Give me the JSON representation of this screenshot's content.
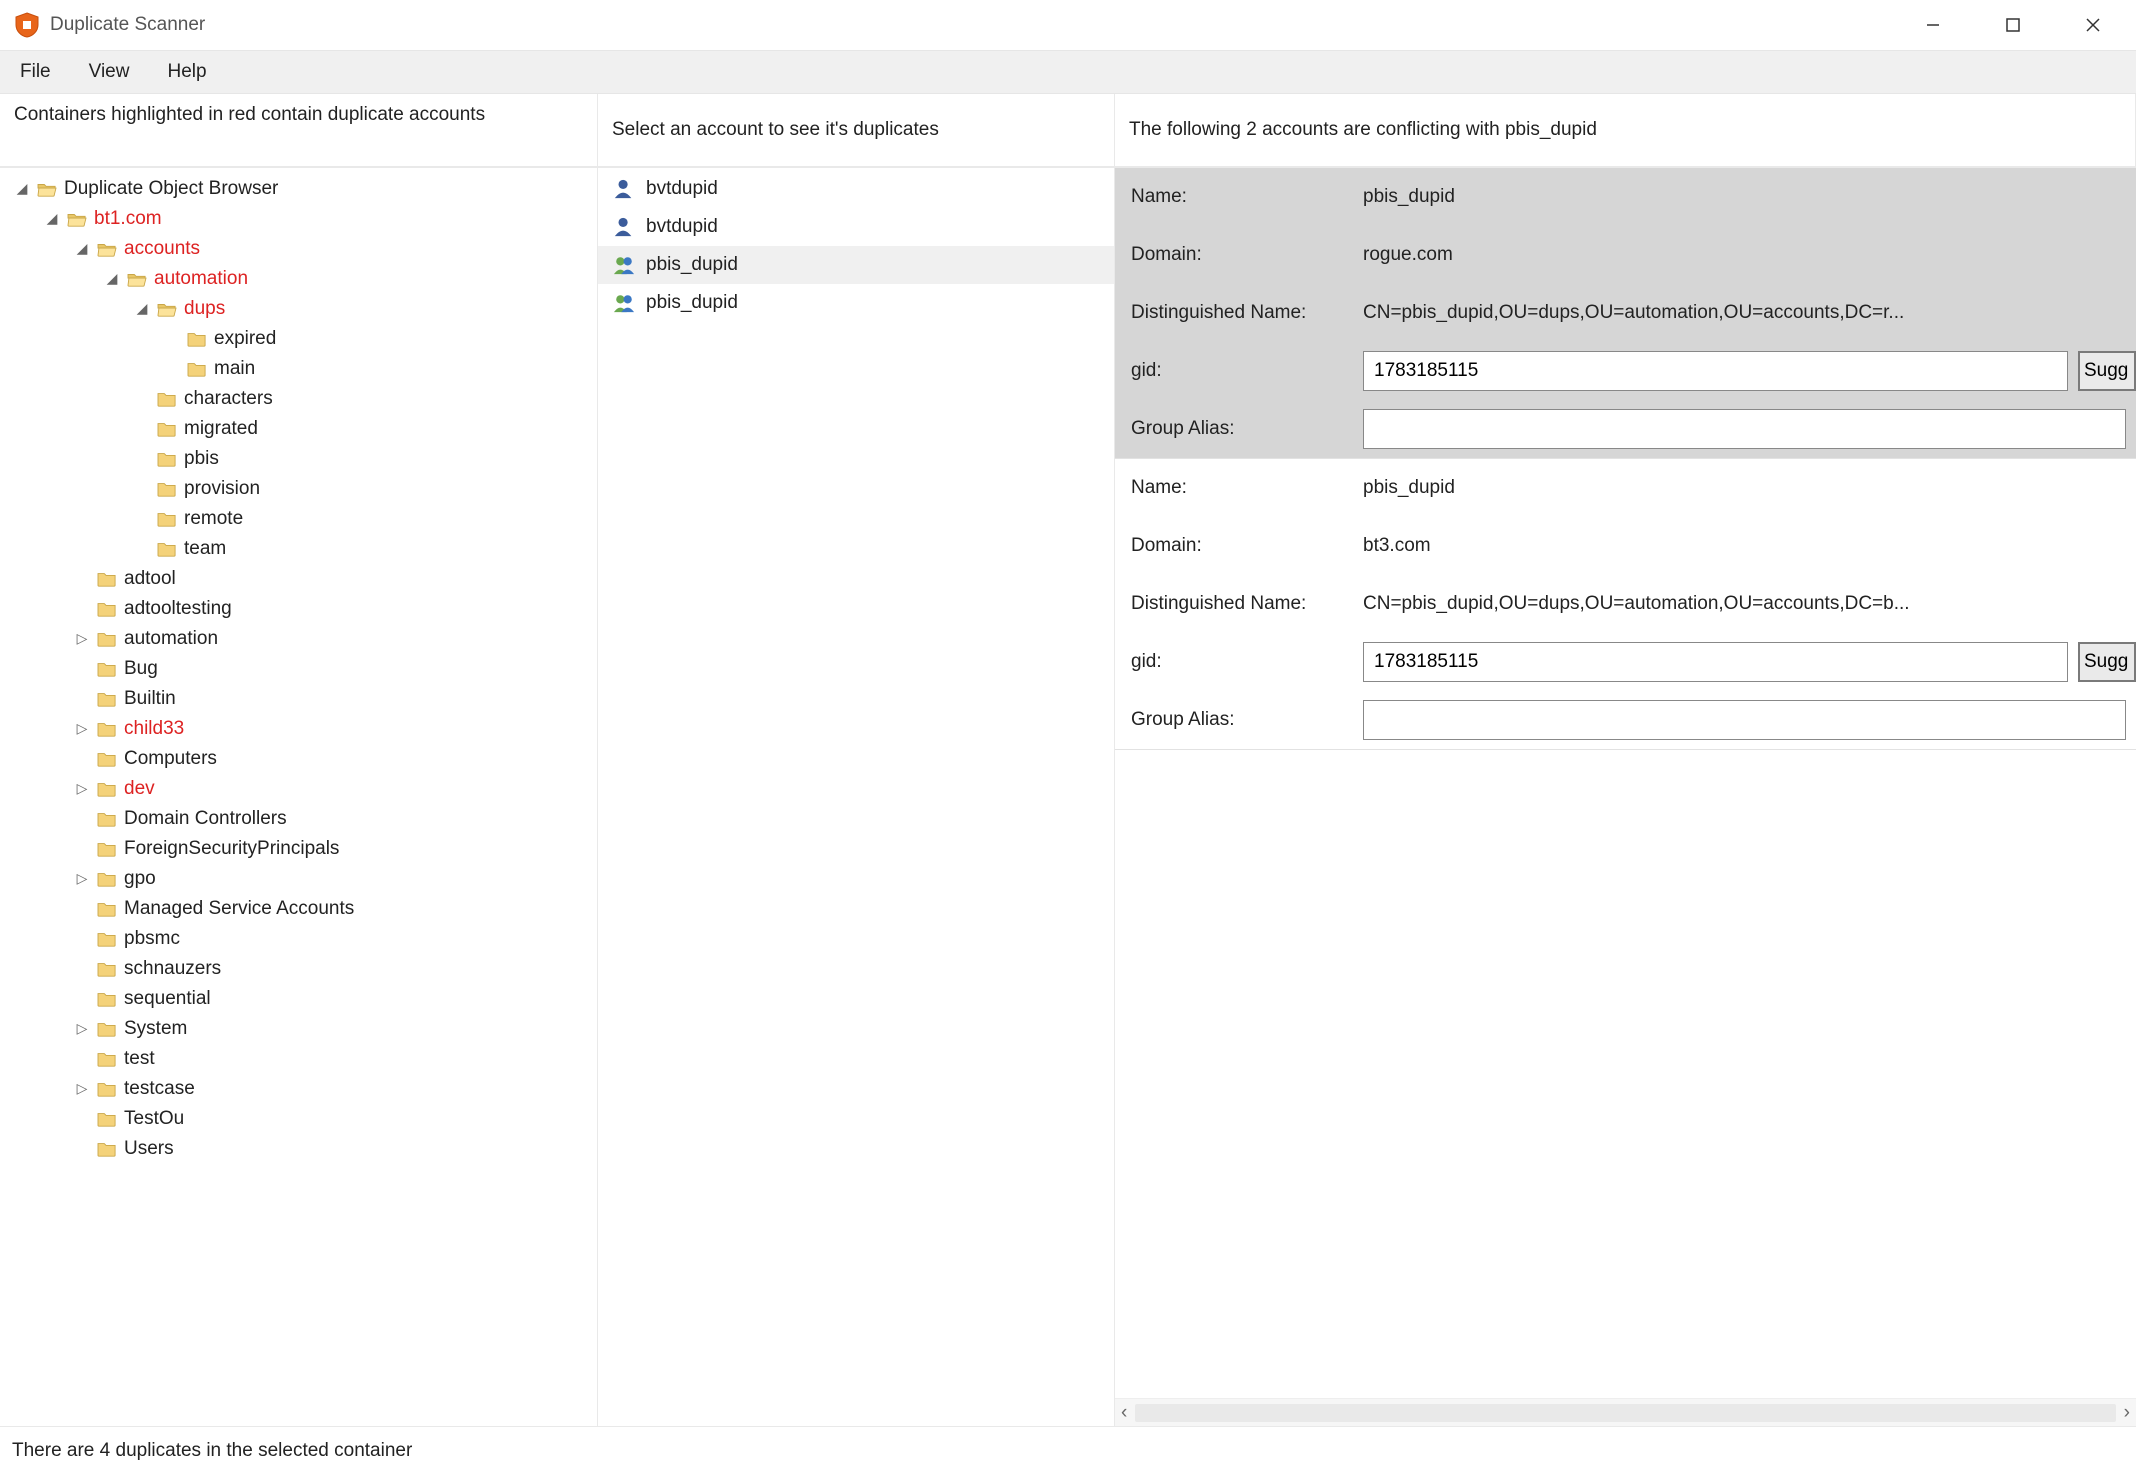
{
  "window": {
    "title": "Duplicate Scanner"
  },
  "menu": {
    "file": "File",
    "view": "View",
    "help": "Help"
  },
  "left": {
    "header": "Containers highlighted in red contain duplicate accounts",
    "root_label": "Duplicate Object Browser",
    "tree": {
      "bt1": "bt1.com",
      "accounts": "accounts",
      "automation_hl": "automation",
      "dups": "dups",
      "expired": "expired",
      "main": "main",
      "characters": "characters",
      "migrated": "migrated",
      "pbis": "pbis",
      "provision": "provision",
      "remote": "remote",
      "team": "team",
      "adtool": "adtool",
      "adtooltesting": "adtooltesting",
      "automation": "automation",
      "bug": "Bug",
      "builtin": "Builtin",
      "child33": "child33",
      "computers": "Computers",
      "dev": "dev",
      "domain_controllers": "Domain Controllers",
      "fsp": "ForeignSecurityPrincipals",
      "gpo": "gpo",
      "msa": "Managed Service Accounts",
      "pbsmc": "pbsmc",
      "schnauzers": "schnauzers",
      "sequential": "sequential",
      "system": "System",
      "test": "test",
      "testcase": "testcase",
      "testou": "TestOu",
      "users": "Users"
    }
  },
  "mid": {
    "header": "Select an account to see it's duplicates",
    "accounts": [
      {
        "label": "bvtdupid",
        "type": "user",
        "selected": false
      },
      {
        "label": "bvtdupid",
        "type": "user",
        "selected": false
      },
      {
        "label": "pbis_dupid",
        "type": "group",
        "selected": true
      },
      {
        "label": "pbis_dupid",
        "type": "group",
        "selected": false
      }
    ]
  },
  "right": {
    "header": "The following 2 accounts are conflicting with pbis_dupid",
    "labels": {
      "name": "Name:",
      "domain": "Domain:",
      "dn": "Distinguished Name:",
      "gid": "gid:",
      "group_alias": "Group Alias:",
      "suggest": "Sugg"
    },
    "conflicts": [
      {
        "active": true,
        "name": "pbis_dupid",
        "domain": "rogue.com",
        "dn": "CN=pbis_dupid,OU=dups,OU=automation,OU=accounts,DC=r...",
        "gid": "1783185115",
        "alias": ""
      },
      {
        "active": false,
        "name": "pbis_dupid",
        "domain": "bt3.com",
        "dn": "CN=pbis_dupid,OU=dups,OU=automation,OU=accounts,DC=b...",
        "gid": "1783185115",
        "alias": ""
      }
    ]
  },
  "status": {
    "text": "There are 4 duplicates in the selected container"
  }
}
